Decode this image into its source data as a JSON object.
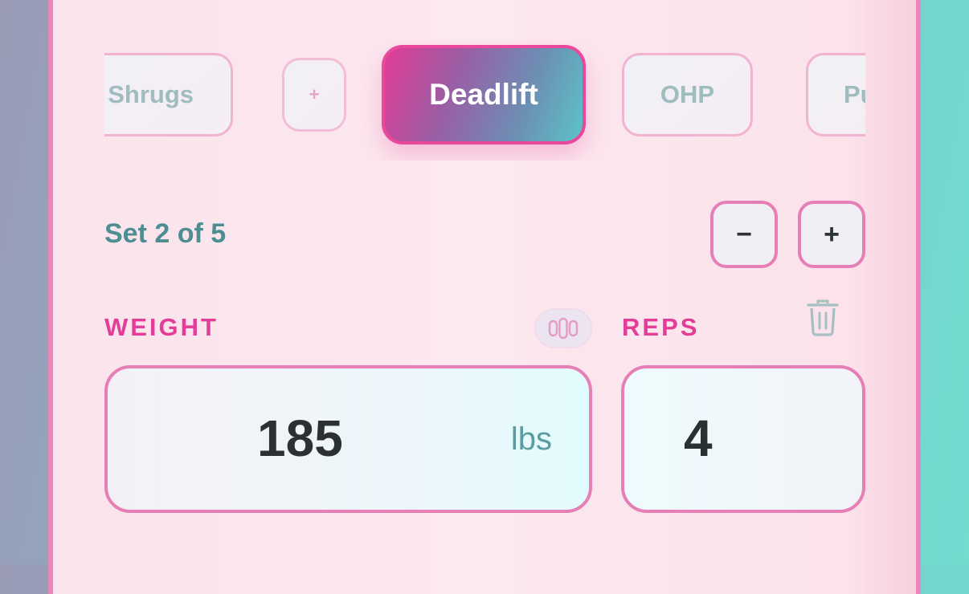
{
  "exercises": {
    "items": [
      {
        "label": "Shrugs"
      },
      {
        "label": "+"
      },
      {
        "label": "Deadlift",
        "active": true
      },
      {
        "label": "OHP"
      },
      {
        "label": "Pu"
      }
    ]
  },
  "set": {
    "label": "Set 2 of 5",
    "minus_label": "−",
    "plus_label": "+"
  },
  "weight": {
    "label": "WEIGHT",
    "value": "185",
    "unit": "lbs"
  },
  "reps": {
    "label": "REPS",
    "value": "4"
  },
  "icons": {
    "plate_toggle": "plates-icon",
    "delete": "trash-icon"
  },
  "colors": {
    "accent_pink": "#e33d97",
    "border_pink": "#e67fb6",
    "teal_text": "#4e8e92",
    "active_gradient_start": "#e13b96",
    "active_gradient_end": "#5cc3c8"
  }
}
